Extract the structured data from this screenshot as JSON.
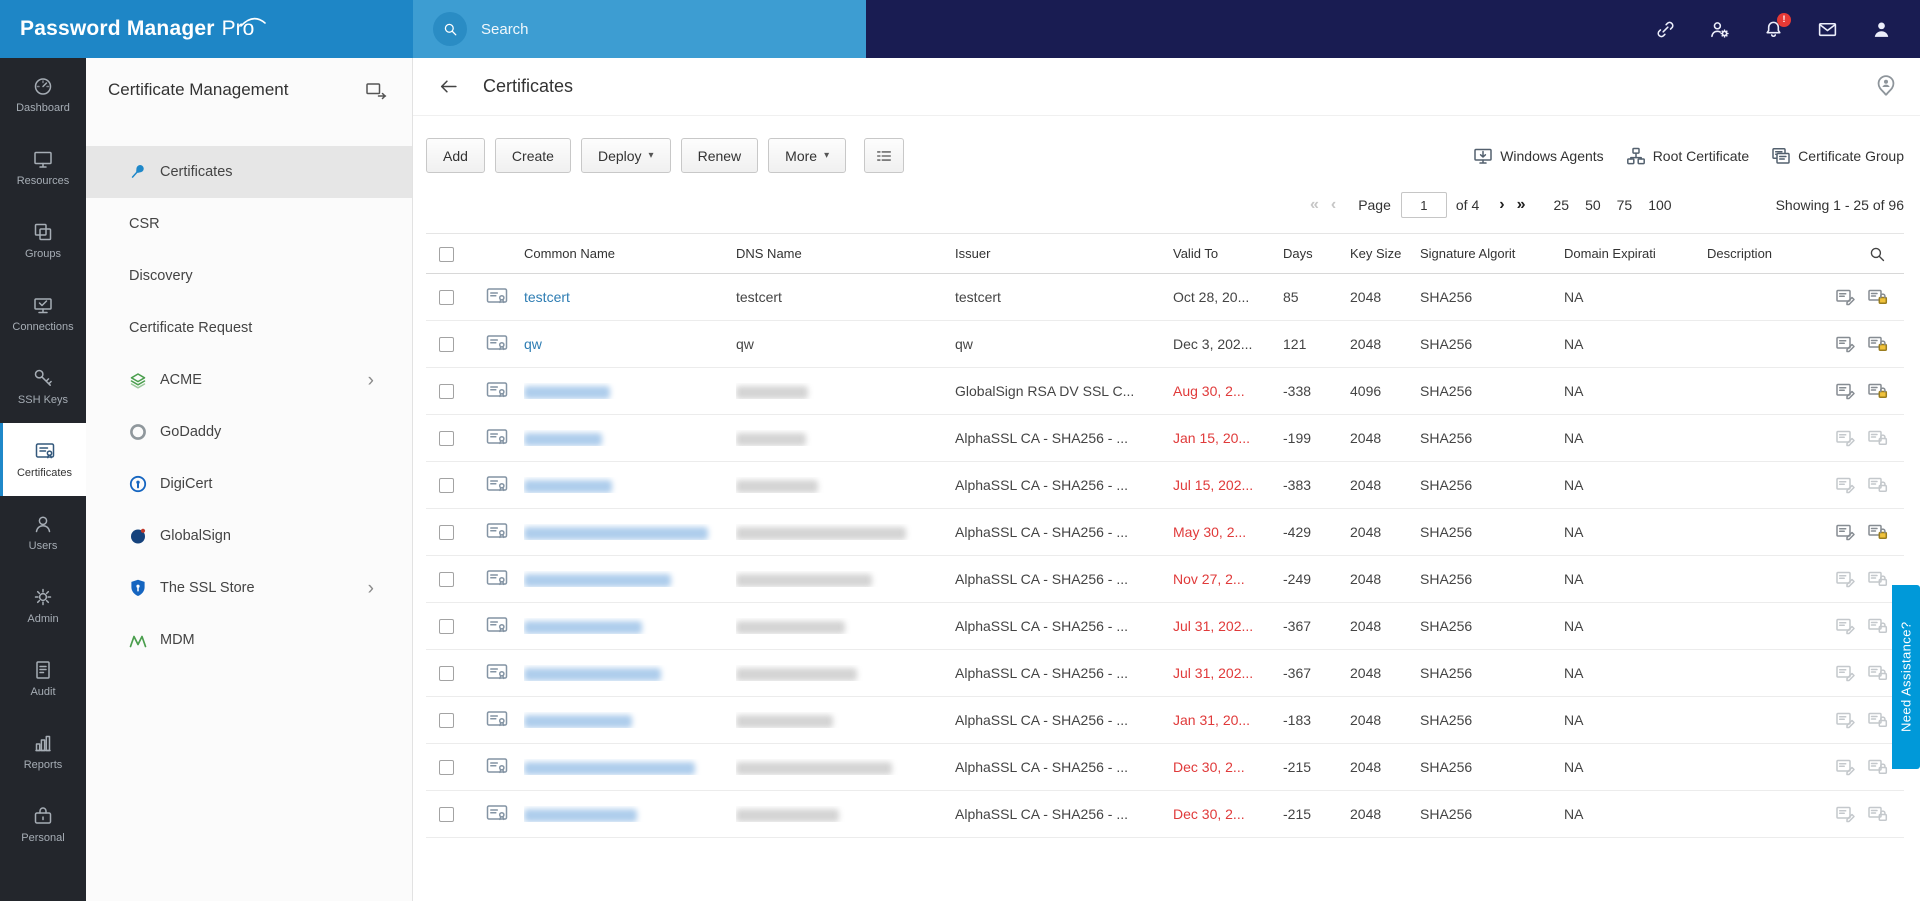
{
  "app": {
    "logo_bold": "Password Manager",
    "logo_pro": "Pro",
    "search_placeholder": "Search"
  },
  "topbar": {
    "badge": "!"
  },
  "colors": {
    "accent_blue": "#1f88c9",
    "topbar_dark": "#191c52",
    "expired_red": "#e03a3a",
    "link_blue": "#2e7db3",
    "assist_blue": "#0099d9"
  },
  "left_rail": {
    "items": [
      {
        "label": "Dashboard",
        "icon": "dashboard",
        "active": false
      },
      {
        "label": "Resources",
        "icon": "resources",
        "active": false
      },
      {
        "label": "Groups",
        "icon": "groups",
        "active": false
      },
      {
        "label": "Connections",
        "icon": "connections",
        "active": false
      },
      {
        "label": "SSH Keys",
        "icon": "sshkeys",
        "active": false
      },
      {
        "label": "Certificates",
        "icon": "certificates",
        "active": true
      },
      {
        "label": "Users",
        "icon": "users",
        "active": false
      },
      {
        "label": "Admin",
        "icon": "admin",
        "active": false
      },
      {
        "label": "Audit",
        "icon": "audit",
        "active": false
      },
      {
        "label": "Reports",
        "icon": "reports",
        "active": false
      },
      {
        "label": "Personal",
        "icon": "personal",
        "active": false
      }
    ]
  },
  "sidebar": {
    "title": "Certificate Management",
    "items": [
      {
        "label": "Certificates",
        "icon": "pin",
        "active": true,
        "chevron": false
      },
      {
        "label": "CSR",
        "icon": "",
        "active": false,
        "chevron": false
      },
      {
        "label": "Discovery",
        "icon": "",
        "active": false,
        "chevron": false
      },
      {
        "label": "Certificate Request",
        "icon": "",
        "active": false,
        "chevron": false
      },
      {
        "label": "ACME",
        "icon": "acme",
        "active": false,
        "chevron": true
      },
      {
        "label": "GoDaddy",
        "icon": "godaddy",
        "active": false,
        "chevron": false
      },
      {
        "label": "DigiCert",
        "icon": "digicert",
        "active": false,
        "chevron": false
      },
      {
        "label": "GlobalSign",
        "icon": "globalsign",
        "active": false,
        "chevron": false
      },
      {
        "label": "The SSL Store",
        "icon": "sslstore",
        "active": false,
        "chevron": true
      },
      {
        "label": "MDM",
        "icon": "mdm",
        "active": false,
        "chevron": false
      }
    ]
  },
  "header": {
    "title": "Certificates"
  },
  "toolbar": {
    "buttons": [
      {
        "label": "Add",
        "caret": false
      },
      {
        "label": "Create",
        "caret": false
      },
      {
        "label": "Deploy",
        "caret": true
      },
      {
        "label": "Renew",
        "caret": false
      },
      {
        "label": "More",
        "caret": true
      }
    ],
    "links": [
      {
        "label": "Windows Agents",
        "icon": "winagents"
      },
      {
        "label": "Root Certificate",
        "icon": "rootcert"
      },
      {
        "label": "Certificate Group",
        "icon": "certgroup"
      }
    ]
  },
  "pagination": {
    "first": "«",
    "prev": "‹",
    "page_label": "Page",
    "page_value": "1",
    "of": "of 4",
    "next": "›",
    "last": "»",
    "sizes": [
      "25",
      "50",
      "75",
      "100"
    ],
    "showing": "Showing 1 - 25 of 96"
  },
  "table": {
    "columns": [
      "Common Name",
      "DNS Name",
      "Issuer",
      "Valid To",
      "Days",
      "Key Size",
      "Signature Algorit",
      "Domain Expirati",
      "Description"
    ],
    "rows": [
      {
        "common": "testcert",
        "common_blur": 0,
        "dns": "testcert",
        "dns_blur": 0,
        "issuer": "testcert",
        "valid_to": "Oct 28, 20...",
        "expired": false,
        "days": "85",
        "key_size": "2048",
        "signature": "SHA256",
        "domain_expiry": "NA",
        "description": "",
        "icons_active": true
      },
      {
        "common": "qw",
        "common_blur": 0,
        "dns": "qw",
        "dns_blur": 0,
        "issuer": "qw",
        "valid_to": "Dec 3, 202...",
        "expired": false,
        "days": "121",
        "key_size": "2048",
        "signature": "SHA256",
        "domain_expiry": "NA",
        "description": "",
        "icons_active": true
      },
      {
        "common": "",
        "common_blur": 86,
        "dns": "",
        "dns_blur": 72,
        "issuer": "GlobalSign RSA DV SSL C...",
        "valid_to": "Aug 30, 2...",
        "expired": true,
        "days": "-338",
        "key_size": "4096",
        "signature": "SHA256",
        "domain_expiry": "NA",
        "description": "",
        "icons_active": true
      },
      {
        "common": "",
        "common_blur": 78,
        "dns": "",
        "dns_blur": 70,
        "issuer": "AlphaSSL CA - SHA256 - ...",
        "valid_to": "Jan 15, 20...",
        "expired": true,
        "days": "-199",
        "key_size": "2048",
        "signature": "SHA256",
        "domain_expiry": "NA",
        "description": "",
        "icons_active": false
      },
      {
        "common": "",
        "common_blur": 88,
        "dns": "",
        "dns_blur": 82,
        "issuer": "AlphaSSL CA - SHA256 - ...",
        "valid_to": "Jul 15, 202...",
        "expired": true,
        "days": "-383",
        "key_size": "2048",
        "signature": "SHA256",
        "domain_expiry": "NA",
        "description": "",
        "icons_active": false
      },
      {
        "common": "",
        "common_blur": 184,
        "dns": "",
        "dns_blur": 170,
        "issuer": "AlphaSSL CA - SHA256 - ...",
        "valid_to": "May 30, 2...",
        "expired": true,
        "days": "-429",
        "key_size": "2048",
        "signature": "SHA256",
        "domain_expiry": "NA",
        "description": "",
        "icons_active": true
      },
      {
        "common": "",
        "common_blur": 147,
        "dns": "",
        "dns_blur": 136,
        "issuer": "AlphaSSL CA - SHA256 - ...",
        "valid_to": "Nov 27, 2...",
        "expired": true,
        "days": "-249",
        "key_size": "2048",
        "signature": "SHA256",
        "domain_expiry": "NA",
        "description": "",
        "icons_active": false
      },
      {
        "common": "",
        "common_blur": 118,
        "dns": "",
        "dns_blur": 109,
        "issuer": "AlphaSSL CA - SHA256 - ...",
        "valid_to": "Jul 31, 202...",
        "expired": true,
        "days": "-367",
        "key_size": "2048",
        "signature": "SHA256",
        "domain_expiry": "NA",
        "description": "",
        "icons_active": false
      },
      {
        "common": "",
        "common_blur": 137,
        "dns": "",
        "dns_blur": 121,
        "issuer": "AlphaSSL CA - SHA256 - ...",
        "valid_to": "Jul 31, 202...",
        "expired": true,
        "days": "-367",
        "key_size": "2048",
        "signature": "SHA256",
        "domain_expiry": "NA",
        "description": "",
        "icons_active": false
      },
      {
        "common": "",
        "common_blur": 108,
        "dns": "",
        "dns_blur": 97,
        "issuer": "AlphaSSL CA - SHA256 - ...",
        "valid_to": "Jan 31, 20...",
        "expired": true,
        "days": "-183",
        "key_size": "2048",
        "signature": "SHA256",
        "domain_expiry": "NA",
        "description": "",
        "icons_active": false
      },
      {
        "common": "",
        "common_blur": 171,
        "dns": "",
        "dns_blur": 156,
        "issuer": "AlphaSSL CA - SHA256 - ...",
        "valid_to": "Dec 30, 2...",
        "expired": true,
        "days": "-215",
        "key_size": "2048",
        "signature": "SHA256",
        "domain_expiry": "NA",
        "description": "",
        "icons_active": false
      },
      {
        "common": "",
        "common_blur": 113,
        "dns": "",
        "dns_blur": 103,
        "issuer": "AlphaSSL CA - SHA256 - ...",
        "valid_to": "Dec 30, 2...",
        "expired": true,
        "days": "-215",
        "key_size": "2048",
        "signature": "SHA256",
        "domain_expiry": "NA",
        "description": "",
        "icons_active": false
      }
    ]
  },
  "assistance": {
    "label": "Need Assistance?"
  }
}
